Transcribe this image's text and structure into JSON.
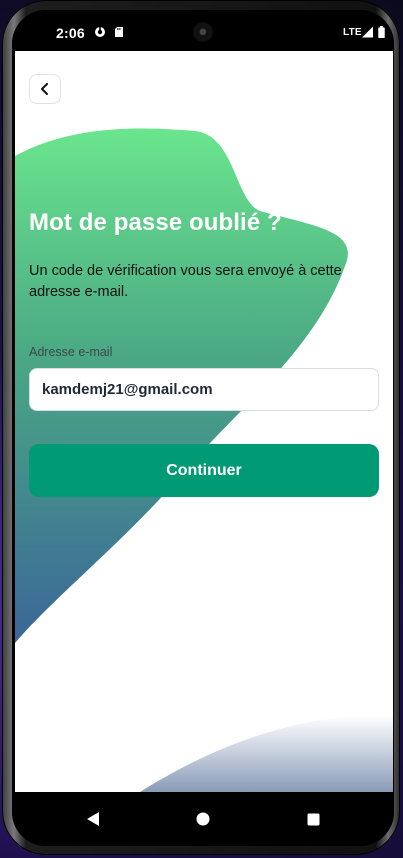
{
  "status_bar": {
    "time": "2:06",
    "network": "LTE",
    "icons": [
      "data-saver-icon",
      "sd-card-icon",
      "signal-icon",
      "battery-icon"
    ]
  },
  "header": {
    "back_icon": "chevron-left-icon"
  },
  "content": {
    "title": "Mot de passe oublié ?",
    "description": "Un code de vérification vous sera envoyé à cette adresse e-mail.",
    "email_label": "Adresse e-mail",
    "email_value": "kamdemj21@gmail.com",
    "continue_label": "Continuer"
  },
  "nav_bar": {
    "buttons": [
      "back-triangle-icon",
      "home-circle-icon",
      "recents-square-icon"
    ]
  },
  "colors": {
    "accent": "#009a74",
    "blob_top": "#6ae58d",
    "blob_bottom": "#3b6698",
    "text": "#111111"
  }
}
